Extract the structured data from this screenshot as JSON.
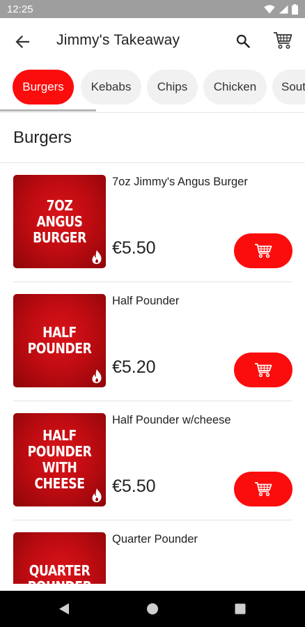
{
  "status_bar": {
    "time": "12:25"
  },
  "header": {
    "title": "Jimmy's Takeaway"
  },
  "categories": [
    {
      "label": "Burgers",
      "active": true
    },
    {
      "label": "Kebabs",
      "active": false
    },
    {
      "label": "Chips",
      "active": false
    },
    {
      "label": "Chicken",
      "active": false
    },
    {
      "label": "South",
      "active": false
    }
  ],
  "section": {
    "title": "Burgers"
  },
  "items": [
    {
      "name": "7oz Jimmy's Angus Burger",
      "price": "€5.50",
      "image_text": "7oz Angus Burger"
    },
    {
      "name": "Half Pounder",
      "price": "€5.20",
      "image_text": "Half Pounder"
    },
    {
      "name": "Half Pounder w/cheese",
      "price": "€5.50",
      "image_text": "Half Pounder with Cheese"
    },
    {
      "name": "Quarter Pounder",
      "price": "",
      "image_text": "Quarter Pounder"
    }
  ],
  "colors": {
    "accent": "#fb0d0d",
    "status_bar": "#9e9e9e",
    "nav_bar": "#000000"
  },
  "icons": [
    "back-arrow-icon",
    "search-icon",
    "cart-icon",
    "add-to-cart-icon",
    "flame-icon",
    "nav-back-icon",
    "nav-home-icon",
    "nav-recents-icon"
  ]
}
